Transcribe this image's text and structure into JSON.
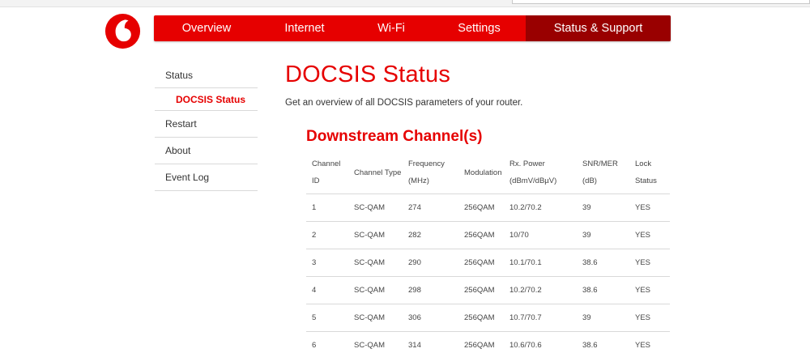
{
  "colors": {
    "brand_red": "#e60000",
    "nav_active": "#990000",
    "divider": "#d9d9d9"
  },
  "logo": {
    "icon": "vodafone-speechmark-icon"
  },
  "nav": {
    "items": [
      {
        "label": "Overview",
        "active": false
      },
      {
        "label": "Internet",
        "active": false
      },
      {
        "label": "Wi-Fi",
        "active": false
      },
      {
        "label": "Settings",
        "active": false
      },
      {
        "label": "Status & Support",
        "active": true
      }
    ]
  },
  "sidebar": {
    "items": [
      {
        "label": "Status"
      },
      {
        "label": "DOCSIS Status",
        "selected": true
      },
      {
        "label": "Restart"
      },
      {
        "label": "About"
      },
      {
        "label": "Event Log"
      }
    ]
  },
  "main": {
    "title": "DOCSIS Status",
    "description": "Get an overview of all DOCSIS parameters of your router.",
    "downstream": {
      "title": "Downstream Channel(s)",
      "headers": [
        [
          "Channel",
          "ID"
        ],
        [
          "Channel Type"
        ],
        [
          "Frequency",
          "(MHz)"
        ],
        [
          "Modulation"
        ],
        [
          "Rx. Power",
          "(dBmV/dBµV)"
        ],
        [
          "SNR/MER",
          "(dB)"
        ],
        [
          "Lock",
          "Status"
        ]
      ],
      "rows": [
        [
          "1",
          "SC-QAM",
          "274",
          "256QAM",
          "10.2/70.2",
          "39",
          "YES"
        ],
        [
          "2",
          "SC-QAM",
          "282",
          "256QAM",
          "10/70",
          "39",
          "YES"
        ],
        [
          "3",
          "SC-QAM",
          "290",
          "256QAM",
          "10.1/70.1",
          "38.6",
          "YES"
        ],
        [
          "4",
          "SC-QAM",
          "298",
          "256QAM",
          "10.2/70.2",
          "38.6",
          "YES"
        ],
        [
          "5",
          "SC-QAM",
          "306",
          "256QAM",
          "10.7/70.7",
          "39",
          "YES"
        ],
        [
          "6",
          "SC-QAM",
          "314",
          "256QAM",
          "10.6/70.6",
          "38.6",
          "YES"
        ]
      ]
    }
  }
}
